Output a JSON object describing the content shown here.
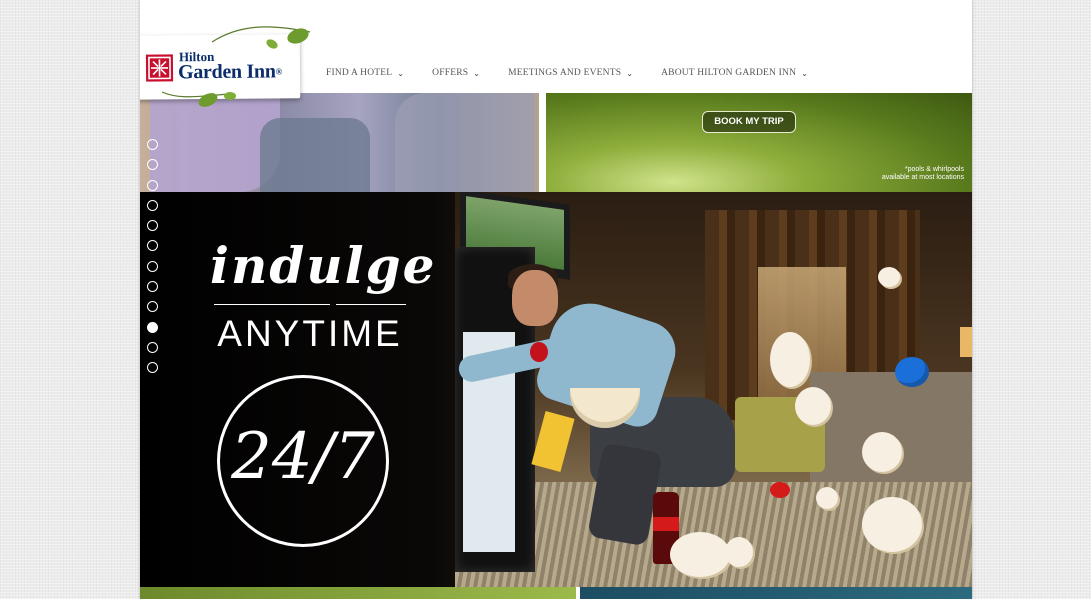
{
  "logo": {
    "line1": "Hilton",
    "line2": "Garden Inn",
    "registered": "®"
  },
  "nav": {
    "items": [
      {
        "label": "FIND A HOTEL"
      },
      {
        "label": "OFFERS"
      },
      {
        "label": "MEETINGS AND EVENTS"
      },
      {
        "label": "ABOUT HILTON GARDEN INN"
      }
    ]
  },
  "promo": {
    "book_label": "BOOK MY TRIP",
    "pools_note_line1": "*pools & whirlpools",
    "pools_note_line2": "available at most locations"
  },
  "hero": {
    "script_word": "indulge",
    "headline": "ANYTIME",
    "badge": "24/7"
  },
  "carousel": {
    "count": 12,
    "active_index": 9
  },
  "colors": {
    "brand_red": "#c8102e",
    "brand_navy": "#0b2d6b",
    "hero_bg": "#000000"
  },
  "icons": {
    "nav_dropdown": "chevron-down-icon",
    "logo_mark": "hilton-logo-icon",
    "vine": "leaf-vine-icon"
  }
}
